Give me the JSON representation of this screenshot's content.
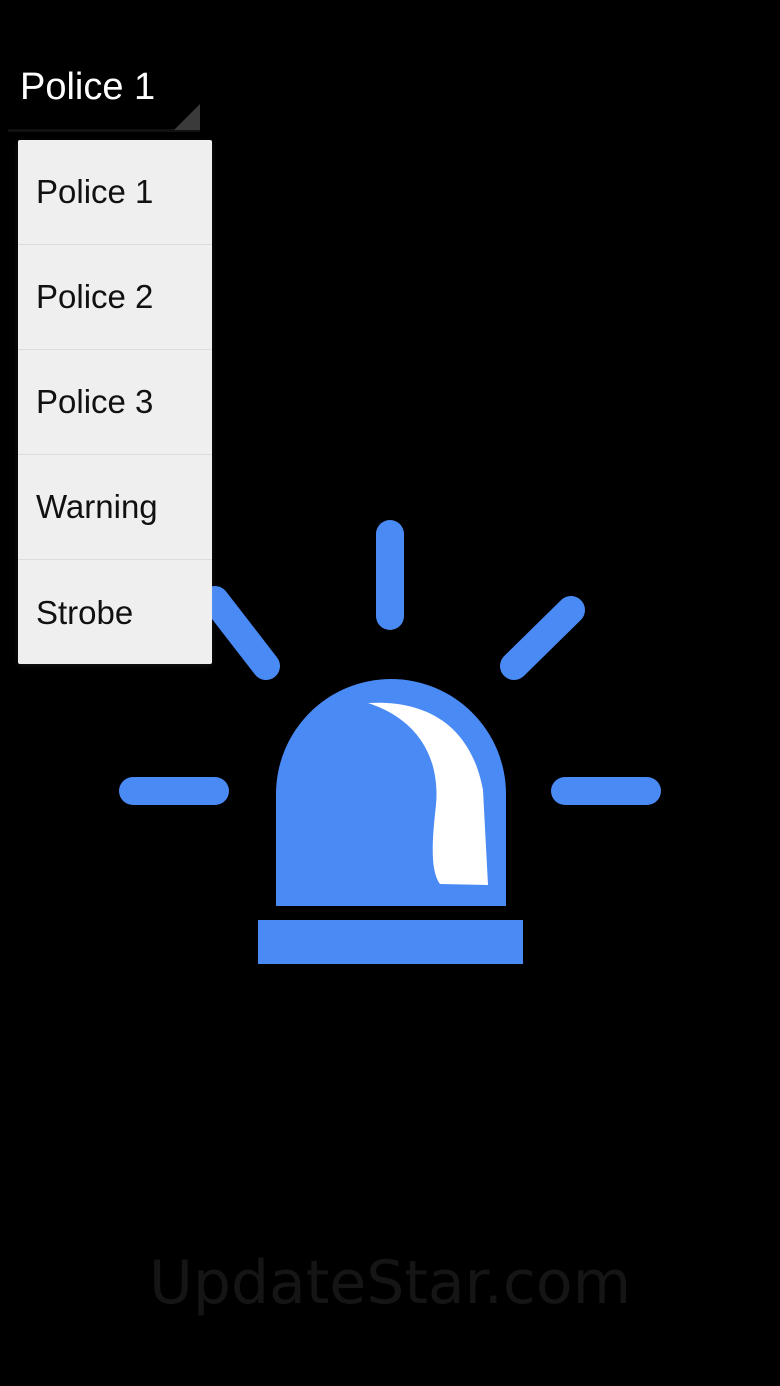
{
  "spinner": {
    "selected": "Police 1"
  },
  "dropdown": {
    "items": [
      {
        "label": "Police 1"
      },
      {
        "label": "Police 2"
      },
      {
        "label": "Police 3"
      },
      {
        "label": "Warning"
      },
      {
        "label": "Strobe"
      }
    ]
  },
  "siren": {
    "icon": "siren-icon",
    "color": "#4a8af4",
    "highlight_color": "#ffffff"
  },
  "watermark": {
    "text": "UpdateStar.com"
  }
}
